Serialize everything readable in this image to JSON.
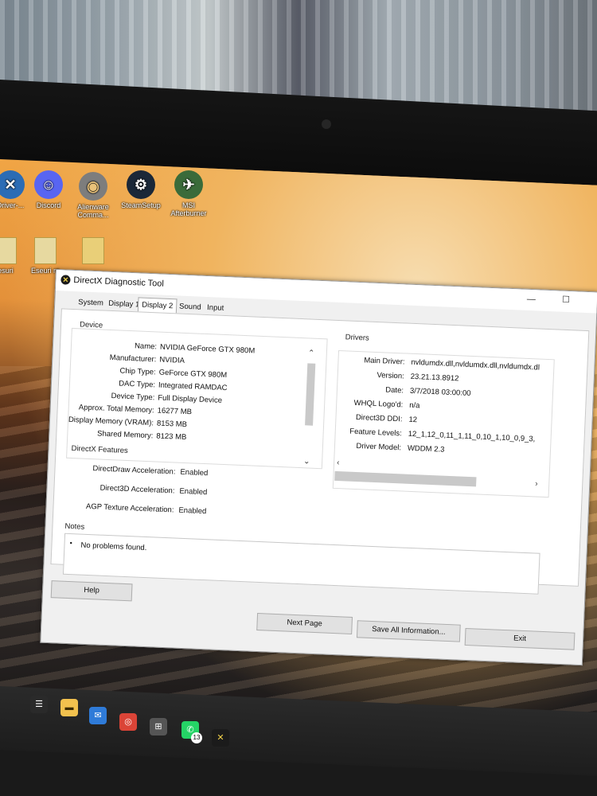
{
  "desktop": {
    "icons": [
      {
        "label": "Driver-...",
        "icon": "driver-app-icon"
      },
      {
        "label": "Discord",
        "icon": "discord-icon"
      },
      {
        "label": "Alienware Comma...",
        "icon": "alienware-icon"
      },
      {
        "label": "SteamSetup",
        "icon": "steam-icon"
      },
      {
        "label": "MSI Afterburner",
        "icon": "msi-afterburner-icon"
      },
      {
        "label": "esuri",
        "icon": "folder-icon"
      },
      {
        "label": "Eseuri ro",
        "icon": "folder-icon"
      },
      {
        "label": "",
        "icon": "zip-folder-icon"
      }
    ]
  },
  "window": {
    "title": "DirectX Diagnostic Tool",
    "tabs": [
      "System",
      "Display 1",
      "Display 2",
      "Sound",
      "Input"
    ],
    "active_tab": "Display 2",
    "device": {
      "label": "Device",
      "rows": [
        {
          "key": "Name:",
          "value": "NVIDIA GeForce GTX 980M"
        },
        {
          "key": "Manufacturer:",
          "value": "NVIDIA"
        },
        {
          "key": "Chip Type:",
          "value": "GeForce GTX 980M"
        },
        {
          "key": "DAC Type:",
          "value": "Integrated RAMDAC"
        },
        {
          "key": "Device Type:",
          "value": "Full Display Device"
        },
        {
          "key": "Approx. Total Memory:",
          "value": "16277 MB"
        },
        {
          "key": "Display Memory (VRAM):",
          "value": "8153 MB"
        },
        {
          "key": "Shared Memory:",
          "value": "8123 MB"
        }
      ]
    },
    "drivers": {
      "label": "Drivers",
      "rows": [
        {
          "key": "Main Driver:",
          "value": "nvldumdx.dll,nvldumdx.dll,nvldumdx.dl"
        },
        {
          "key": "Version:",
          "value": "23.21.13.8912"
        },
        {
          "key": "Date:",
          "value": "3/7/2018 03:00:00"
        },
        {
          "key": "WHQL Logo'd:",
          "value": "n/a"
        },
        {
          "key": "Direct3D DDI:",
          "value": "12"
        },
        {
          "key": "Feature Levels:",
          "value": "12_1,12_0,11_1,11_0,10_1,10_0,9_3,"
        },
        {
          "key": "Driver Model:",
          "value": "WDDM 2.3"
        }
      ]
    },
    "features": {
      "label": "DirectX Features",
      "rows": [
        {
          "key": "DirectDraw Acceleration:",
          "value": "Enabled"
        },
        {
          "key": "Direct3D Acceleration:",
          "value": "Enabled"
        },
        {
          "key": "AGP Texture Acceleration:",
          "value": "Enabled"
        }
      ]
    },
    "notes": {
      "label": "Notes",
      "items": [
        "No problems found."
      ]
    },
    "buttons": {
      "help": "Help",
      "next_page": "Next Page",
      "save_all": "Save All Information...",
      "exit": "Exit"
    }
  },
  "taskbar": {
    "badge_count": "13",
    "icons": [
      "task-view-icon",
      "file-explorer-icon",
      "mail-icon",
      "chrome-icon",
      "store-icon",
      "whatsapp-icon",
      "dxdiag-icon"
    ]
  }
}
